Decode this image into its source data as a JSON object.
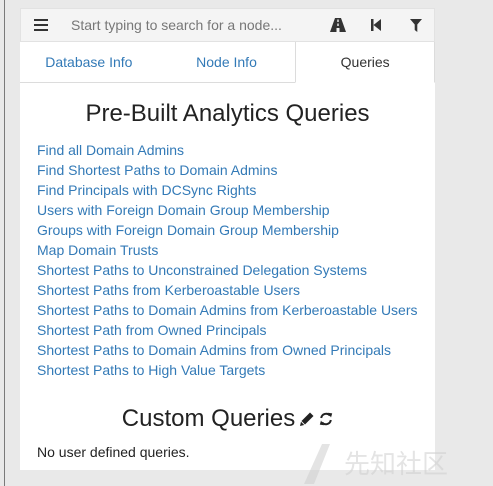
{
  "search": {
    "placeholder": "Start typing to search for a node..."
  },
  "toolbar": {
    "menu_icon": "hamburger-menu-icon",
    "path_icon": "road-icon",
    "back_icon": "step-backward-icon",
    "filter_icon": "filter-icon"
  },
  "tabs": [
    {
      "label": "Database Info",
      "active": false
    },
    {
      "label": "Node Info",
      "active": false
    },
    {
      "label": "Queries",
      "active": true
    }
  ],
  "prebuilt": {
    "title": "Pre-Built Analytics Queries",
    "queries": [
      "Find all Domain Admins",
      "Find Shortest Paths to Domain Admins",
      "Find Principals with DCSync Rights",
      "Users with Foreign Domain Group Membership",
      "Groups with Foreign Domain Group Membership",
      "Map Domain Trusts",
      "Shortest Paths to Unconstrained Delegation Systems",
      "Shortest Paths from Kerberoastable Users",
      "Shortest Paths to Domain Admins from Kerberoastable Users",
      "Shortest Path from Owned Principals",
      "Shortest Paths to Domain Admins from Owned Principals",
      "Shortest Paths to High Value Targets"
    ]
  },
  "custom": {
    "title": "Custom Queries",
    "edit_icon": "pencil-icon",
    "refresh_icon": "refresh-icon",
    "empty_text": "No user defined queries."
  },
  "watermark": {
    "text": "先知社区"
  },
  "colors": {
    "link": "#337ab7",
    "text": "#222222",
    "toolbar_bg": "#f4f4f4",
    "page_bg": "#e9e9e9"
  }
}
